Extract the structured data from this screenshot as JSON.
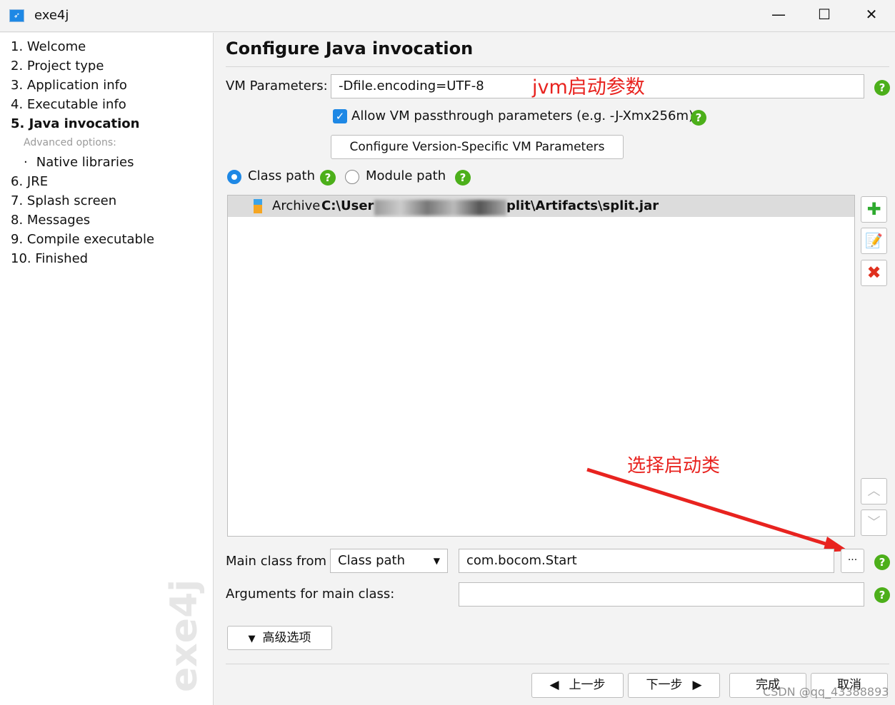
{
  "window": {
    "title": "exe4j",
    "min": "—",
    "max": "☐",
    "close": "✕"
  },
  "sidebar": {
    "steps": [
      "1. Welcome",
      "2. Project type",
      "3. Application info",
      "4. Executable info",
      "5. Java invocation"
    ],
    "advanced_label": "Advanced options:",
    "sub_item": "Native libraries",
    "steps_after": [
      "6. JRE",
      "7. Splash screen",
      "8. Messages",
      "9. Compile executable",
      "10. Finished"
    ],
    "watermark": "exe4j",
    "active": "5. Java invocation"
  },
  "main": {
    "title": "Configure Java invocation",
    "vm_label": "VM Parameters:",
    "vm_value": "-Dfile.encoding=UTF-8",
    "passthrough_label": "Allow VM passthrough parameters (e.g. -J-Xmx256m)",
    "passthrough_checked": true,
    "version_button": "Configure Version-Specific VM Parameters",
    "class_path": "Class path",
    "module_path": "Module path",
    "selected_path": "Class path",
    "archive": {
      "prefix": "Archive ",
      "path_start": "C:\\User",
      "path_end": "plit\\Artifacts\\split.jar"
    },
    "main_class_label": "Main class from",
    "main_class_source": "Class path",
    "main_class_value": "com.bocom.Start",
    "browse": "···",
    "args_label": "Arguments for main class:",
    "args_value": "",
    "advanced_button": "高级选项"
  },
  "annotations": {
    "jvm": "jvm启动参数",
    "select": "选择启动类",
    "color": "#e8231f"
  },
  "footer": {
    "prev": "上一步",
    "next": "下一步",
    "finish": "完成",
    "cancel": "取消",
    "credit": "CSDN @qq_43388893"
  }
}
